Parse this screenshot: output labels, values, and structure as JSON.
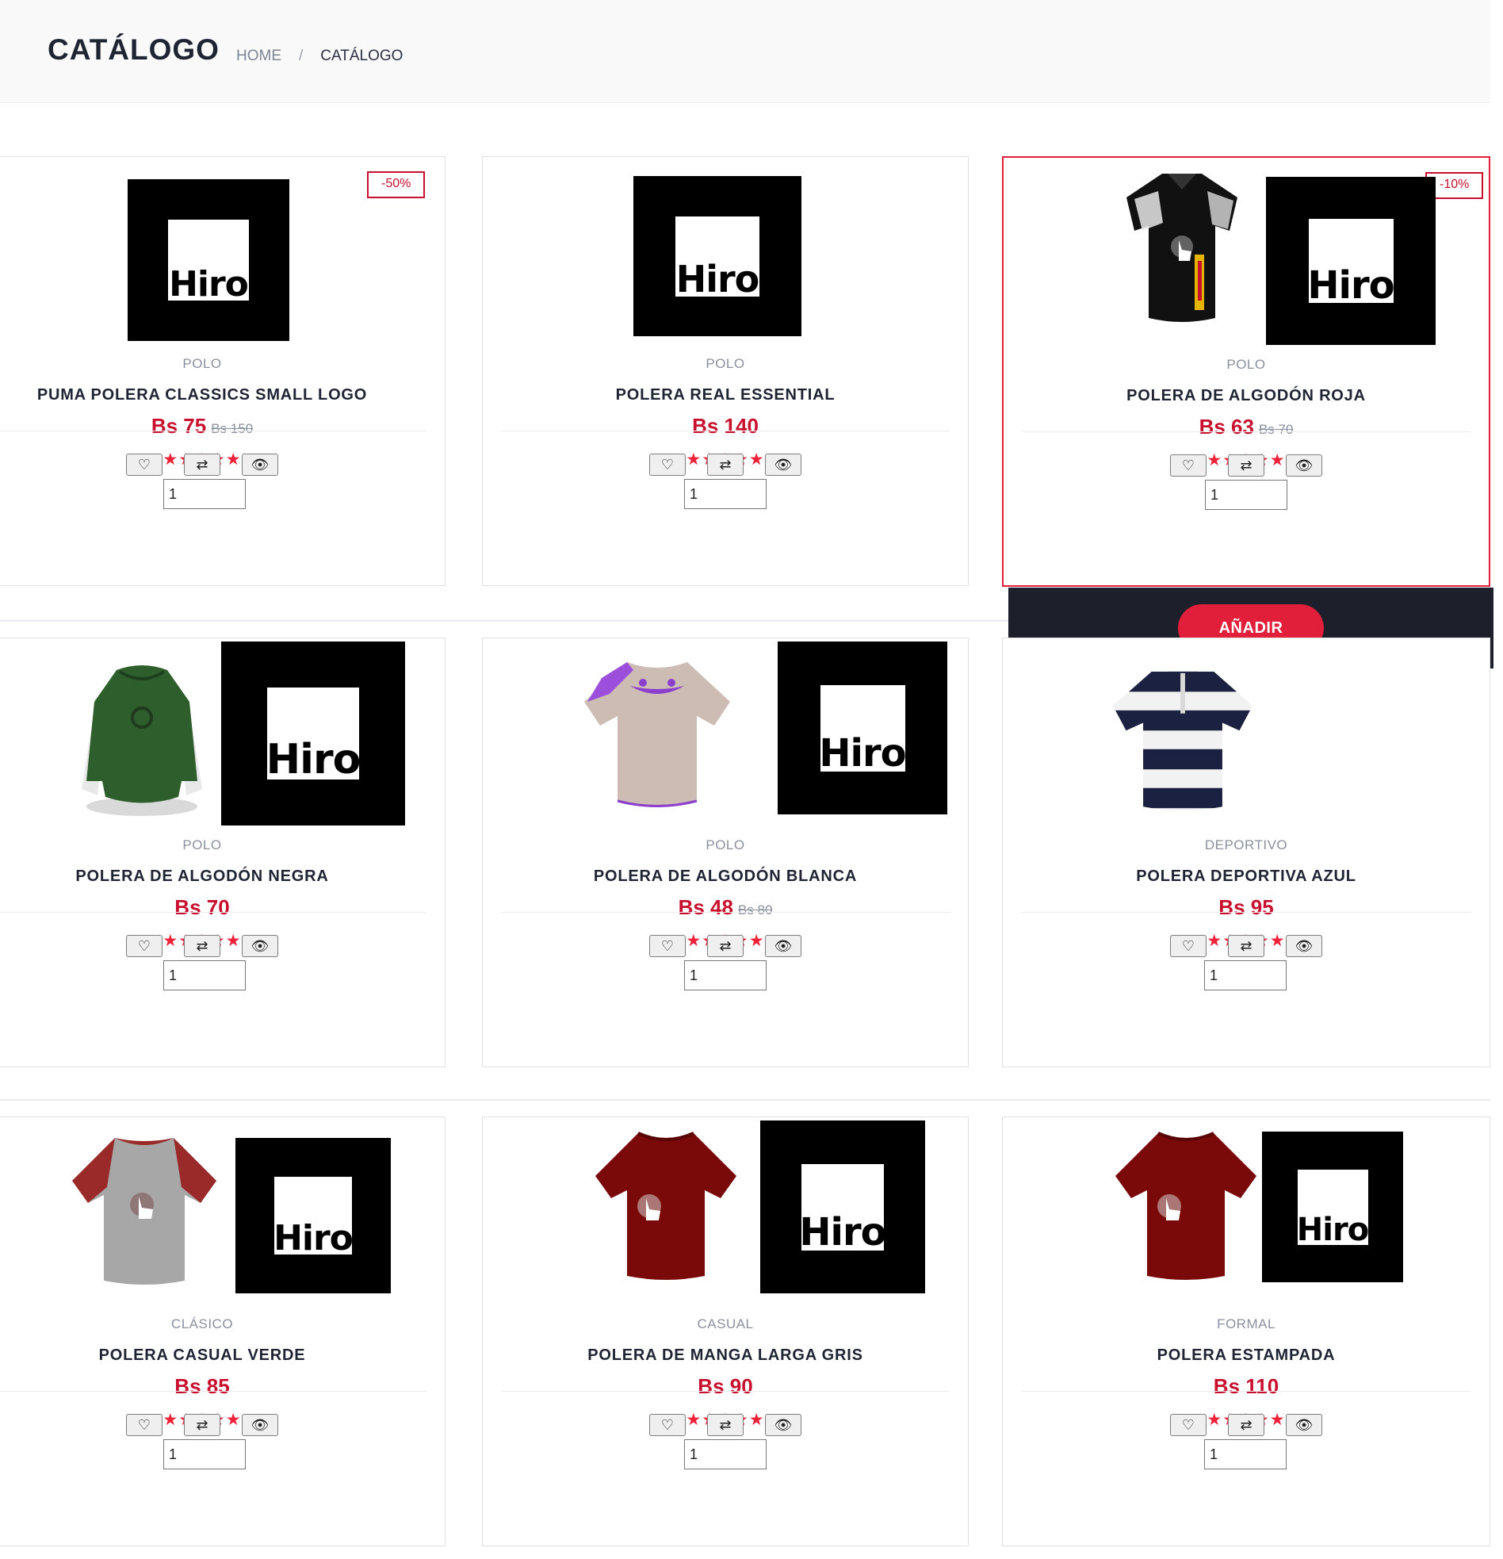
{
  "header": {
    "title": "CATÁLOGO",
    "breadcrumb": {
      "home": "HOME",
      "separator": "/",
      "current": "CATÁLOGO"
    }
  },
  "overlay": {
    "add_label": "AÑADIR"
  },
  "ui": {
    "hiro_text": "Hiro",
    "qty_default": "1",
    "star_glyphs": "★★★★★"
  },
  "products": [
    {
      "category": "POLO",
      "title": "PUMA POLERA CLASSICS SMALL LOGO",
      "price": "Bs 75",
      "old_price": "Bs 150",
      "badge": "-50%",
      "rating": 5
    },
    {
      "category": "POLO",
      "title": "POLERA REAL ESSENTIAL",
      "price": "Bs 140",
      "old_price": "",
      "badge": "",
      "rating": 5
    },
    {
      "category": "POLO",
      "title": "POLERA DE ALGODÓN ROJA",
      "price": "Bs 63",
      "old_price": "Bs 70",
      "badge": "-10%",
      "rating": 5
    },
    {
      "category": "POLO",
      "title": "POLERA DE ALGODÓN NEGRA",
      "price": "Bs 70",
      "old_price": "",
      "badge": "",
      "rating": 5
    },
    {
      "category": "POLO",
      "title": "POLERA DE ALGODÓN BLANCA",
      "price": "Bs 48",
      "old_price": "Bs 80",
      "badge": "",
      "rating": 5
    },
    {
      "category": "DEPORTIVO",
      "title": "POLERA DEPORTIVA AZUL",
      "price": "Bs 95",
      "old_price": "",
      "badge": "",
      "rating": 5
    },
    {
      "category": "CLÁSICO",
      "title": "POLERA CASUAL VERDE",
      "price": "Bs 85",
      "old_price": "",
      "badge": "",
      "rating": 5
    },
    {
      "category": "CASUAL",
      "title": "POLERA DE MANGA LARGA GRIS",
      "price": "Bs 90",
      "old_price": "",
      "badge": "",
      "rating": 5
    },
    {
      "category": "FORMAL",
      "title": "POLERA ESTAMPADA",
      "price": "Bs 110",
      "old_price": "",
      "badge": "",
      "rating": 5
    }
  ],
  "colors": {
    "accent": "#e21f3a",
    "price": "#c8102e",
    "dark": "#1d1f2b",
    "text": "#1f2433",
    "muted": "#8a919d"
  }
}
